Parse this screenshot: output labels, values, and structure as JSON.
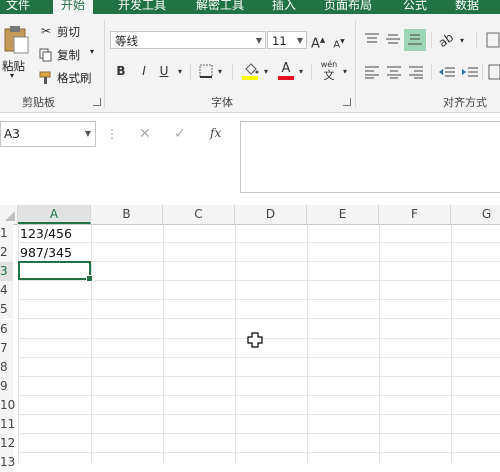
{
  "tabs": [
    {
      "label": "文件"
    },
    {
      "label": "开始"
    },
    {
      "label": "开发工具"
    },
    {
      "label": "解密工具"
    },
    {
      "label": "插入"
    },
    {
      "label": "页面布局"
    },
    {
      "label": "公式"
    },
    {
      "label": "数据"
    }
  ],
  "active_tab": "开始",
  "clipboard": {
    "paste_label": "粘贴",
    "cut_label": "剪切",
    "copy_label": "复制",
    "format_painter_label": "格式刷",
    "group_label": "剪贴板"
  },
  "font": {
    "font_name": "等线",
    "font_size": "11",
    "grow_label": "A",
    "shrink_label": "A",
    "bold_label": "B",
    "italic_label": "I",
    "underline_label": "U",
    "font_color_label": "A",
    "phonetic_top": "wén",
    "phonetic_bottom": "文",
    "group_label": "字体",
    "fill_color": "#ffff00",
    "font_color": "#e81123"
  },
  "alignment": {
    "group_label": "对齐方式"
  },
  "namebox": {
    "value": "A3"
  },
  "formula_bar": {
    "fx_label": "fx",
    "value": ""
  },
  "sheet": {
    "columns": [
      "A",
      "B",
      "C",
      "D",
      "E",
      "F",
      "G"
    ],
    "rows": [
      "1",
      "2",
      "3",
      "4",
      "5",
      "6",
      "7",
      "8",
      "9",
      "10",
      "11",
      "12",
      "13"
    ],
    "cells": {
      "A1": "123/456",
      "A2": "987/345",
      "A3": ""
    },
    "selected_cell": "A3",
    "accent": "#217346"
  }
}
